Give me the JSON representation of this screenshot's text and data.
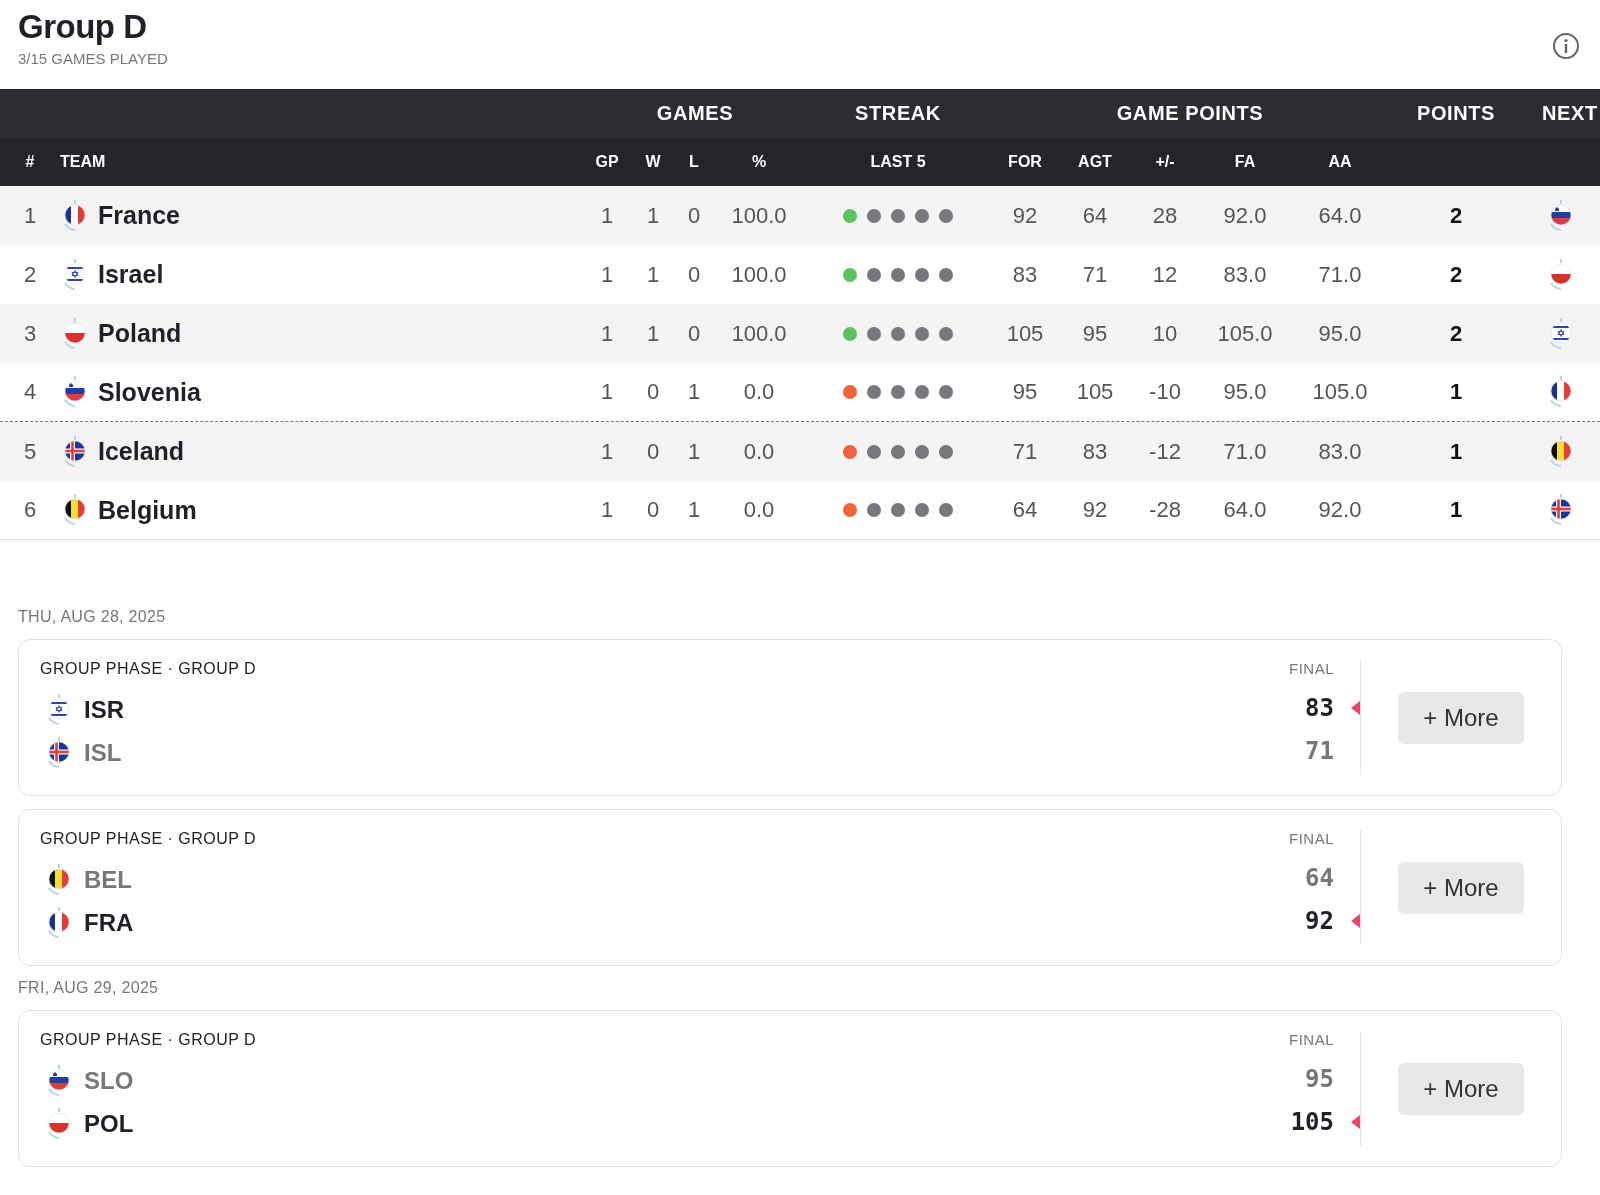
{
  "header": {
    "title": "Group D",
    "subtitle": "3/15 GAMES PLAYED"
  },
  "table": {
    "groups": [
      "GAMES",
      "STREAK",
      "GAME POINTS",
      "POINTS",
      "NEXT"
    ],
    "columns": [
      "#",
      "TEAM",
      "GP",
      "W",
      "L",
      "%",
      "LAST 5",
      "FOR",
      "AGT",
      "+/-",
      "FA",
      "AA"
    ],
    "rows": [
      {
        "rank": "1",
        "flag": {
          "kind": "france"
        },
        "team": "France",
        "gp": "1",
        "w": "1",
        "l": "0",
        "pct": "100.0",
        "streak": [
          {
            "color": "#5cc15e"
          },
          {
            "color": "#77777c"
          },
          {
            "color": "#77777c"
          },
          {
            "color": "#77777c"
          },
          {
            "color": "#77777c"
          }
        ],
        "for": "92",
        "agt": "64",
        "diff": "28",
        "fa": "92.0",
        "aa": "64.0",
        "points": "2",
        "next_flag": {
          "kind": "slovenia"
        },
        "cutoff_below": false
      },
      {
        "rank": "2",
        "flag": {
          "kind": "israel"
        },
        "team": "Israel",
        "gp": "1",
        "w": "1",
        "l": "0",
        "pct": "100.0",
        "streak": [
          {
            "color": "#5cc15e"
          },
          {
            "color": "#77777c"
          },
          {
            "color": "#77777c"
          },
          {
            "color": "#77777c"
          },
          {
            "color": "#77777c"
          }
        ],
        "for": "83",
        "agt": "71",
        "diff": "12",
        "fa": "83.0",
        "aa": "71.0",
        "points": "2",
        "next_flag": {
          "kind": "poland"
        },
        "cutoff_below": false
      },
      {
        "rank": "3",
        "flag": {
          "kind": "poland"
        },
        "team": "Poland",
        "gp": "1",
        "w": "1",
        "l": "0",
        "pct": "100.0",
        "streak": [
          {
            "color": "#5cc15e"
          },
          {
            "color": "#77777c"
          },
          {
            "color": "#77777c"
          },
          {
            "color": "#77777c"
          },
          {
            "color": "#77777c"
          }
        ],
        "for": "105",
        "agt": "95",
        "diff": "10",
        "fa": "105.0",
        "aa": "95.0",
        "points": "2",
        "next_flag": {
          "kind": "israel"
        },
        "cutoff_below": false
      },
      {
        "rank": "4",
        "flag": {
          "kind": "slovenia"
        },
        "team": "Slovenia",
        "gp": "1",
        "w": "0",
        "l": "1",
        "pct": "0.0",
        "streak": [
          {
            "color": "#ef643d"
          },
          {
            "color": "#77777c"
          },
          {
            "color": "#77777c"
          },
          {
            "color": "#77777c"
          },
          {
            "color": "#77777c"
          }
        ],
        "for": "95",
        "agt": "105",
        "diff": "-10",
        "fa": "95.0",
        "aa": "105.0",
        "points": "1",
        "next_flag": {
          "kind": "france"
        },
        "cutoff_below": true
      },
      {
        "rank": "5",
        "flag": {
          "kind": "iceland"
        },
        "team": "Iceland",
        "gp": "1",
        "w": "0",
        "l": "1",
        "pct": "0.0",
        "streak": [
          {
            "color": "#ef643d"
          },
          {
            "color": "#77777c"
          },
          {
            "color": "#77777c"
          },
          {
            "color": "#77777c"
          },
          {
            "color": "#77777c"
          }
        ],
        "for": "71",
        "agt": "83",
        "diff": "-12",
        "fa": "71.0",
        "aa": "83.0",
        "points": "1",
        "next_flag": {
          "kind": "belgium"
        },
        "cutoff_below": false
      },
      {
        "rank": "6",
        "flag": {
          "kind": "belgium"
        },
        "team": "Belgium",
        "gp": "1",
        "w": "0",
        "l": "1",
        "pct": "0.0",
        "streak": [
          {
            "color": "#ef643d"
          },
          {
            "color": "#77777c"
          },
          {
            "color": "#77777c"
          },
          {
            "color": "#77777c"
          },
          {
            "color": "#77777c"
          }
        ],
        "for": "64",
        "agt": "92",
        "diff": "-28",
        "fa": "64.0",
        "aa": "92.0",
        "points": "1",
        "next_flag": {
          "kind": "iceland"
        },
        "cutoff_below": false
      }
    ]
  },
  "days": [
    {
      "date": "THU, AUG 28, 2025",
      "games": [
        {
          "phase": "GROUP PHASE · GROUP D",
          "status": "FINAL",
          "button": "+ More",
          "teams": [
            {
              "flag": {
                "kind": "israel"
              },
              "code": "ISR",
              "score": "83",
              "winner": true
            },
            {
              "flag": {
                "kind": "iceland"
              },
              "code": "ISL",
              "score": "71",
              "winner": false
            }
          ]
        },
        {
          "phase": "GROUP PHASE · GROUP D",
          "status": "FINAL",
          "button": "+ More",
          "teams": [
            {
              "flag": {
                "kind": "belgium"
              },
              "code": "BEL",
              "score": "64",
              "winner": false
            },
            {
              "flag": {
                "kind": "france"
              },
              "code": "FRA",
              "score": "92",
              "winner": true
            }
          ]
        }
      ]
    },
    {
      "date": "FRI, AUG 29, 2025",
      "games": [
        {
          "phase": "GROUP PHASE · GROUP D",
          "status": "FINAL",
          "button": "+ More",
          "teams": [
            {
              "flag": {
                "kind": "slovenia"
              },
              "code": "SLO",
              "score": "95",
              "winner": false
            },
            {
              "flag": {
                "kind": "poland"
              },
              "code": "POL",
              "score": "105",
              "winner": true
            }
          ]
        }
      ]
    }
  ]
}
